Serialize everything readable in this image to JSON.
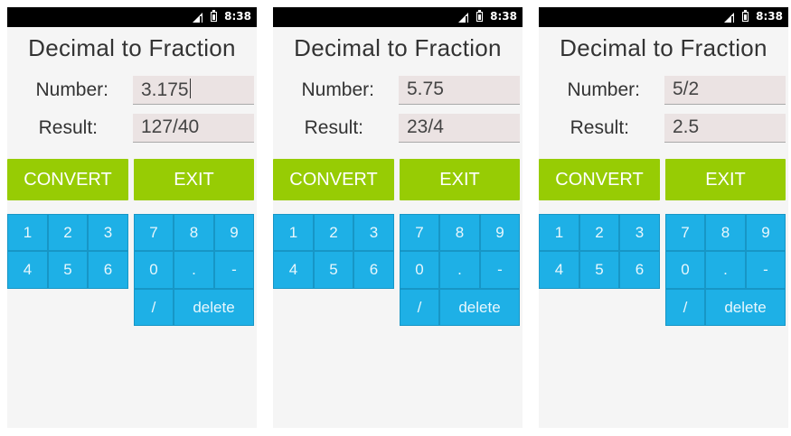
{
  "screens": [
    {
      "status": {
        "time": "8:38"
      },
      "title": "Decimal to Fraction",
      "number_label": "Number:",
      "result_label": "Result:",
      "number_value": "3.175",
      "result_value": "127/40",
      "convert_label": "CONVERT",
      "exit_label": "EXIT",
      "keys": {
        "k1": "1",
        "k2": "2",
        "k3": "3",
        "k4": "4",
        "k5": "5",
        "k6": "6",
        "k7": "7",
        "k8": "8",
        "k9": "9",
        "k0": "0",
        "dot": ".",
        "minus": "-",
        "slash": "/",
        "del": "delete"
      }
    },
    {
      "status": {
        "time": "8:38"
      },
      "title": "Decimal to Fraction",
      "number_label": "Number:",
      "result_label": "Result:",
      "number_value": "5.75",
      "result_value": "23/4",
      "convert_label": "CONVERT",
      "exit_label": "EXIT",
      "keys": {
        "k1": "1",
        "k2": "2",
        "k3": "3",
        "k4": "4",
        "k5": "5",
        "k6": "6",
        "k7": "7",
        "k8": "8",
        "k9": "9",
        "k0": "0",
        "dot": ".",
        "minus": "-",
        "slash": "/",
        "del": "delete"
      }
    },
    {
      "status": {
        "time": "8:38"
      },
      "title": "Decimal to Fraction",
      "number_label": "Number:",
      "result_label": "Result:",
      "number_value": "5/2",
      "result_value": "2.5",
      "convert_label": "CONVERT",
      "exit_label": "EXIT",
      "keys": {
        "k1": "1",
        "k2": "2",
        "k3": "3",
        "k4": "4",
        "k5": "5",
        "k6": "6",
        "k7": "7",
        "k8": "8",
        "k9": "9",
        "k0": "0",
        "dot": ".",
        "minus": "-",
        "slash": "/",
        "del": "delete"
      }
    }
  ],
  "colors": {
    "accent_green": "#97cc04",
    "key_blue": "#1eb0e6",
    "status_bar": "#000000"
  }
}
